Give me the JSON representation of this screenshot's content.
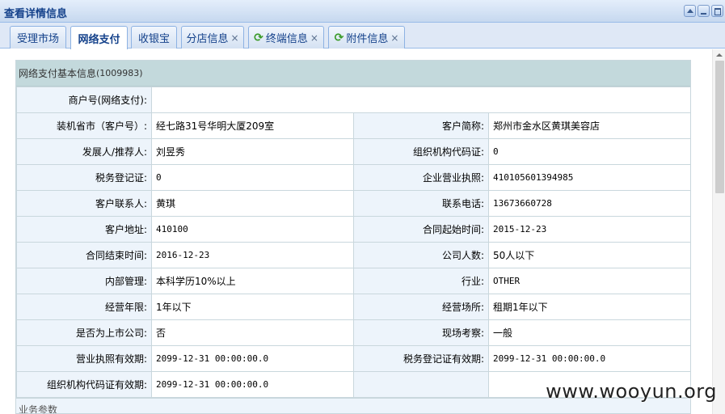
{
  "window": {
    "title": "查看详情信息",
    "buttons": [
      "collapse",
      "minimize",
      "maximize"
    ]
  },
  "tabs": [
    {
      "label": "受理市场",
      "active": false,
      "closable": false
    },
    {
      "label": "网络支付",
      "active": true,
      "closable": false
    },
    {
      "label": "收银宝",
      "active": false,
      "closable": false
    },
    {
      "label": "分店信息",
      "active": false,
      "closable": true
    },
    {
      "label": "终端信息",
      "active": false,
      "closable": true,
      "icon": "refresh-icon"
    },
    {
      "label": "附件信息",
      "active": false,
      "closable": true,
      "icon": "refresh-icon"
    }
  ],
  "panel": {
    "title": "网络支付基本信息",
    "code": "(1009983)",
    "rows": [
      {
        "l1": "商户号(网络支付):",
        "v1": ""
      },
      {
        "l1": "装机省市（客户号）:",
        "v1": "经七路31号华明大厦209室",
        "l2": "客户简称:",
        "v2": "郑州市金水区黄琪美容店"
      },
      {
        "l1": "发展人/推荐人:",
        "v1": "刘昱秀",
        "l2": "组织机构代码证:",
        "v2": "0"
      },
      {
        "l1": "税务登记证:",
        "v1": "0",
        "l2": "企业营业执照:",
        "v2": "410105601394985"
      },
      {
        "l1": "客户联系人:",
        "v1": "黄琪",
        "l2": "联系电话:",
        "v2": "13673660728"
      },
      {
        "l1": "客户地址:",
        "v1": "410100",
        "l2": "合同起始时间:",
        "v2": "2015-12-23"
      },
      {
        "l1": "合同结束时间:",
        "v1": "2016-12-23",
        "l2": "公司人数:",
        "v2": "50人以下"
      },
      {
        "l1": "内部管理:",
        "v1": "本科学历10%以上",
        "l2": "行业:",
        "v2": "OTHER"
      },
      {
        "l1": "经营年限:",
        "v1": "1年以下",
        "l2": "经营场所:",
        "v2": "租期1年以下"
      },
      {
        "l1": "是否为上市公司:",
        "v1": "否",
        "l2": "现场考察:",
        "v2": "一般"
      },
      {
        "l1": "营业执照有效期:",
        "v1": "2099-12-31 00:00:00.0",
        "l2": "税务登记证有效期:",
        "v2": "2099-12-31 00:00:00.0"
      },
      {
        "l1": "组织机构代码证有效期:",
        "v1": "2099-12-31 00:00:00.0",
        "l2": "",
        "v2": ""
      }
    ],
    "next_section": "业务参数"
  },
  "watermark": "www.wooyun.org"
}
